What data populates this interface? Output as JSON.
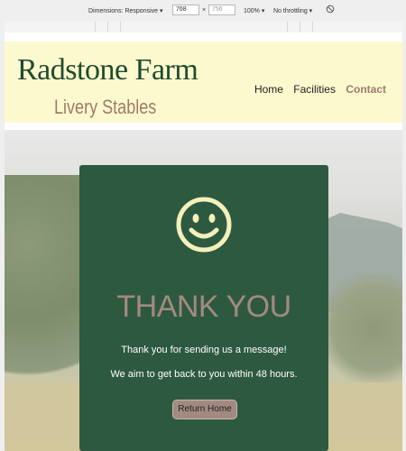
{
  "devtools": {
    "dimensions_label": "Dimensions: Responsive ▾",
    "width_value": "768",
    "times": "×",
    "height_value": "756",
    "zoom": "100% ▾",
    "throttling": "No throttling ▾"
  },
  "header": {
    "title": "Radstone Farm",
    "subtitle": "Livery Stables"
  },
  "nav": {
    "items": [
      {
        "label": "Home"
      },
      {
        "label": "Facilities"
      },
      {
        "label": "Contact"
      }
    ],
    "active_color": "#9a7b70"
  },
  "card": {
    "icon": "smiley-face-icon",
    "title": "THANK YOU",
    "message_line1": "Thank you for sending us a message!",
    "message_line2": "We aim to get back to you within 48 hours.",
    "button_label": "Return Home"
  },
  "colors": {
    "header_bg": "#fdf9cf",
    "brand_green": "#1f4c2e",
    "card_green": "#2d5940",
    "accent_rose": "#a38a81",
    "icon_cream": "#f4f0bb"
  }
}
